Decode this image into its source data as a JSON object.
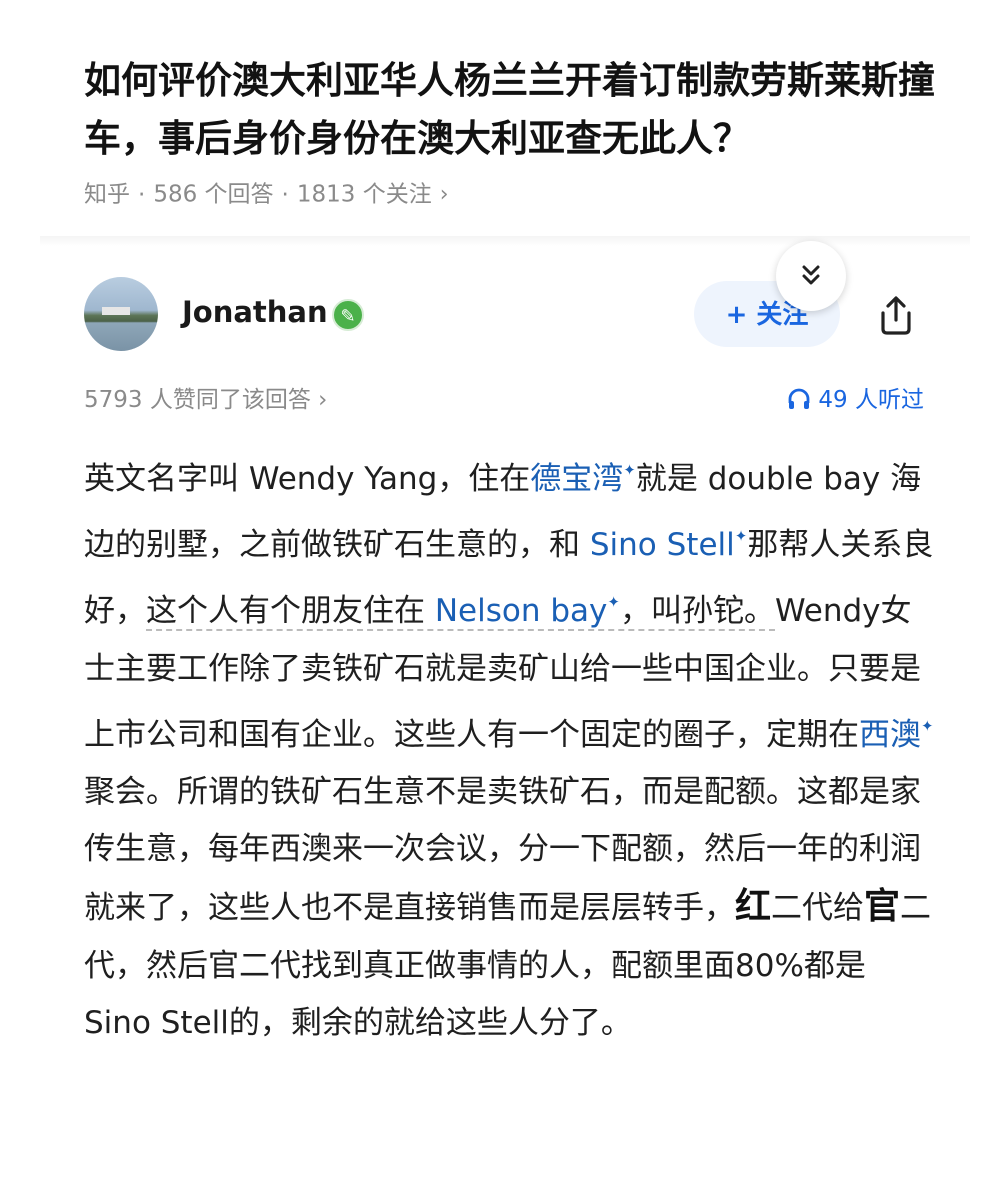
{
  "question": {
    "title": "如何评价澳大利亚华人杨兰兰开着订制款劳斯莱斯撞车，事后身价身份在澳大利亚查无此人？",
    "source": "知乎",
    "answers": "586 个回答",
    "followers": "1813 个关注"
  },
  "author": {
    "name": "Jonathan",
    "follow_label": "+ 关注",
    "collapse_icon": "chevron-double-down",
    "share_icon": "share"
  },
  "stats": {
    "upvotes": "5793 人赞同了该回答 ›",
    "listens": "49 人听过"
  },
  "answer": {
    "p1": "英文名字叫 Wendy Yang，住在",
    "link1": "德宝湾",
    "p2": "就是 double bay 海边的别墅，之前做铁矿石生意的，和 ",
    "link2": "Sino Stell",
    "p3": "那帮人关系良好，",
    "p3b": "这个人有个朋友住在 ",
    "link3": "Nelson bay",
    "p4": "，叫孙铊。",
    "p4b": "Wendy女士主要工作除了卖铁矿石就是卖矿山给一些中国企业。只要是上市公司和国有企业。这些人有一个固定的圈子，定期在",
    "link4": "西澳",
    "p5": "聚会。所谓的铁矿石生意不是卖铁矿石，而是配额。这都是家传生意，每年西澳来一次会议，分一下配额，然后一年的利润就来了，这些人也不是直接销售而是层层转手，",
    "hong": "红",
    "p6": "二代给",
    "guan": "官",
    "p7": "二代，然后官二代找到真正做事情的人，配额里面80%都是 Sino Stell的，剩余的就给这些人分了。"
  },
  "colors": {
    "link": "#1a5fb4",
    "follow_bg": "#eef4fd",
    "follow_text": "#1a66e0",
    "meta_gray": "#8a8a8a",
    "verified": "#4bb14a"
  }
}
